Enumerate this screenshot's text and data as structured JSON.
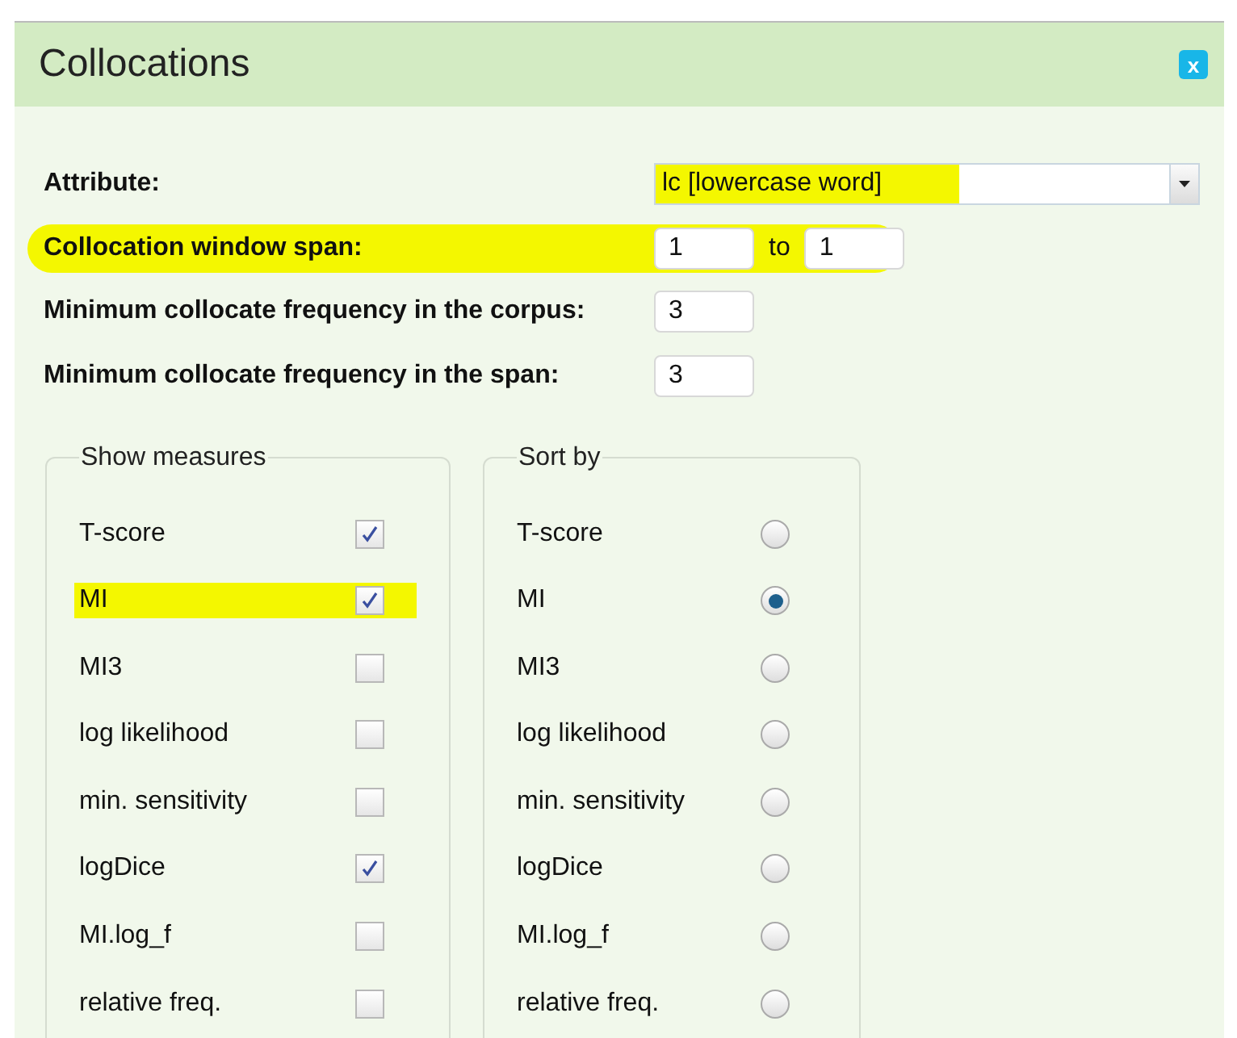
{
  "dialog": {
    "title": "Collocations",
    "close_label": "x"
  },
  "fields": [
    {
      "kind": "select",
      "label": "Attribute:",
      "value": "lc [lowercase word]",
      "highlighted": true
    },
    {
      "kind": "range",
      "label": "Collocation window span:",
      "from": "1",
      "separator": "to",
      "to": "1",
      "highlighted": true
    },
    {
      "kind": "number",
      "label": "Minimum collocate frequency in the corpus:",
      "value": "3",
      "highlighted": false
    },
    {
      "kind": "number",
      "label": "Minimum collocate frequency in the span:",
      "value": "3",
      "highlighted": false
    }
  ],
  "show_measures": {
    "legend": "Show measures",
    "items": [
      {
        "label": "T-score",
        "checked": true,
        "highlighted": false
      },
      {
        "label": "MI",
        "checked": true,
        "highlighted": true
      },
      {
        "label": "MI3",
        "checked": false,
        "highlighted": false
      },
      {
        "label": "log likelihood",
        "checked": false,
        "highlighted": false
      },
      {
        "label": "min. sensitivity",
        "checked": false,
        "highlighted": false
      },
      {
        "label": "logDice",
        "checked": true,
        "highlighted": false
      },
      {
        "label": "MI.log_f",
        "checked": false,
        "highlighted": false
      },
      {
        "label": "relative freq.",
        "checked": false,
        "highlighted": false
      }
    ]
  },
  "sort_by": {
    "legend": "Sort by",
    "items": [
      {
        "label": "T-score",
        "selected": false
      },
      {
        "label": "MI",
        "selected": true
      },
      {
        "label": "MI3",
        "selected": false
      },
      {
        "label": "log likelihood",
        "selected": false
      },
      {
        "label": "min. sensitivity",
        "selected": false
      },
      {
        "label": "logDice",
        "selected": false
      },
      {
        "label": "MI.log_f",
        "selected": false
      },
      {
        "label": "relative freq.",
        "selected": false
      }
    ]
  }
}
